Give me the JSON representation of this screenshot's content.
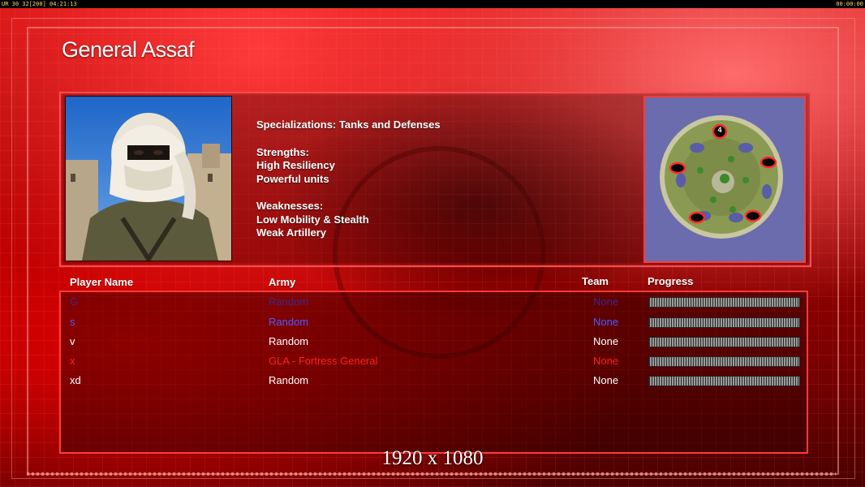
{
  "hud": {
    "top_left_text": "UR 30 32[200] 04:21:13",
    "top_right_text": "00:00:00"
  },
  "general": {
    "name": "General Assaf",
    "specializations": "Specializations: Tanks and Defenses",
    "strengths_heading": "Strengths:",
    "strengths": [
      "High Resiliency",
      "Powerful units"
    ],
    "weaknesses_heading": "Weaknesses:",
    "weaknesses": [
      "Low Mobility & Stealth",
      "Weak Artillery"
    ]
  },
  "map": {
    "numbered_slot": "4"
  },
  "table": {
    "headers": {
      "player": "Player Name",
      "army": "Army",
      "team": "Team",
      "progress": "Progress"
    },
    "rows": [
      {
        "name": "G",
        "army": "Random",
        "team": "None",
        "color": "#3a2a8a",
        "progress": 0.0
      },
      {
        "name": "s",
        "army": "Random",
        "team": "None",
        "color": "#4a5cff",
        "progress": 0.0
      },
      {
        "name": "v",
        "army": "Random",
        "team": "None",
        "color": "#ffffff",
        "progress": 0.0
      },
      {
        "name": "x",
        "army": "GLA - Fortress General",
        "team": "None",
        "color": "#ff2020",
        "progress": 0.0
      },
      {
        "name": "xd",
        "army": "Random",
        "team": "None",
        "color": "#ffffff",
        "progress": 0.0
      }
    ]
  },
  "resolution_label": "1920 x 1080",
  "colors": {
    "accent": "#ff3a3a",
    "background": "#b00000"
  }
}
